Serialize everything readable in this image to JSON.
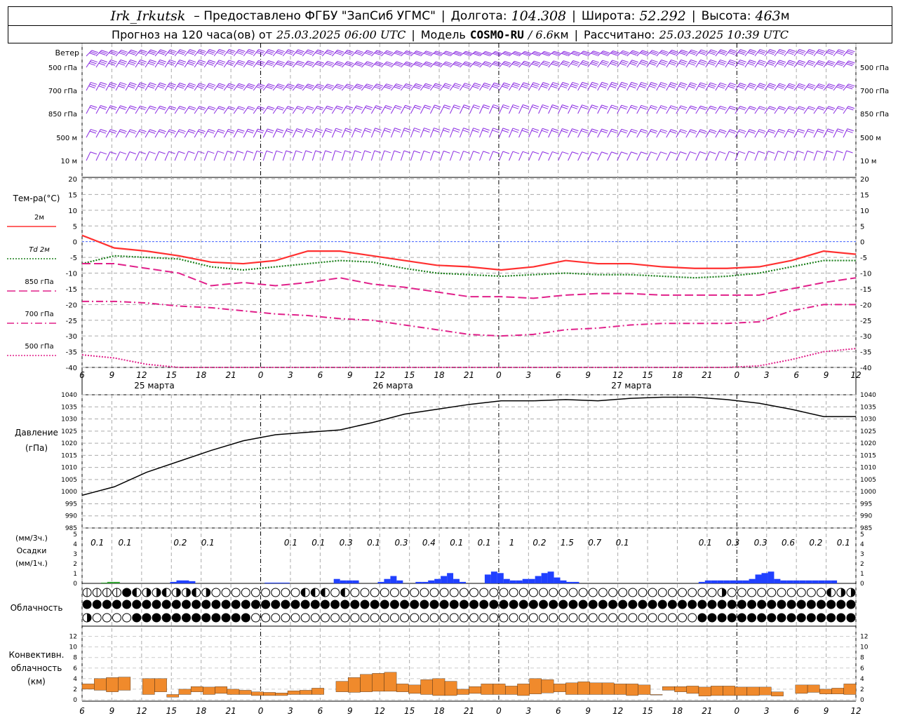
{
  "header": {
    "station": "Irk_Irkutsk",
    "provider": "– Предоставлено ФГБУ \"ЗапСиб УГМС\"",
    "lon_label": "Долгота:",
    "lon_value": "104.308",
    "lat_label": "Широта:",
    "lat_value": "52.292",
    "alt_label": "Высота:",
    "alt_value": "463",
    "alt_unit": "м",
    "forecast_label": "Прогноз на 120 часа(ов) от",
    "forecast_start": "25.03.2025 06:00 UTC",
    "model_label": "Модель",
    "model_name": "COSMO-RU",
    "model_res": "/ 6.6",
    "model_res_unit": "км",
    "calc_label": "Рассчитано:",
    "calc_time": "25.03.2025 10:39 UTC"
  },
  "panels": {
    "wind": {
      "title": "Ветер",
      "levels": [
        "500 гПа",
        "700 гПа",
        "850 гПа",
        "500 м",
        "10  м"
      ],
      "color": "#8a2be2"
    },
    "temp": {
      "title": "Тем-ра(°C)",
      "legend": [
        {
          "label": "2м",
          "color": "#ff3030",
          "dash": ""
        },
        {
          "label": "Td  2м",
          "color": "#1a7f1a",
          "dash": "2,2"
        },
        {
          "label": "850 гПа",
          "color": "#e0208a",
          "dash": "12,5"
        },
        {
          "label": "700 гПа",
          "color": "#e0208a",
          "dash": "10,4,2,4"
        },
        {
          "label": "500 гПа",
          "color": "#e0208a",
          "dash": "2,2"
        }
      ]
    },
    "pressure": {
      "title1": "Давление",
      "title2": "(гПа)"
    },
    "precip": {
      "unit3h": "(мм/3ч.)",
      "title": "Осадки",
      "unit1h": "(мм/1ч.)"
    },
    "cloud": {
      "title": "Облачность"
    },
    "conv": {
      "title1": "Конвективн.",
      "title2": "облачность",
      "title3": "(км)"
    }
  },
  "chart_data": {
    "type": "line",
    "x_hours_utc": [
      "6",
      "9",
      "12",
      "15",
      "18",
      "21",
      "0",
      "3",
      "6",
      "9",
      "12",
      "15",
      "18",
      "21",
      "0",
      "3",
      "6",
      "9",
      "12",
      "15",
      "18",
      "21",
      "0",
      "3",
      "6",
      "9",
      "12"
    ],
    "date_labels": [
      "25 марта",
      "26 марта",
      "27 марта"
    ],
    "temperature": {
      "ylim": [
        -40,
        20
      ],
      "yticks": [
        "20",
        "15",
        "10",
        "5",
        "0",
        "-5",
        "-10",
        "-15",
        "-20",
        "-25",
        "-30",
        "-35",
        "-40"
      ],
      "series": [
        {
          "name": "2м",
          "values": [
            2,
            -2,
            -3,
            -4.5,
            -6.5,
            -7,
            -6,
            -3,
            -3,
            -4.5,
            -6,
            -7.5,
            -8,
            -9,
            -8,
            -6,
            -7,
            -7,
            -8,
            -8.5,
            -8.5,
            -8,
            -6,
            -3,
            -4
          ]
        },
        {
          "name": "Td  2м",
          "values": [
            -7,
            -4.5,
            -5,
            -5.5,
            -8,
            -9,
            -8,
            -7,
            -6,
            -6.5,
            -8.5,
            -10,
            -10.5,
            -11,
            -10.5,
            -10,
            -10.5,
            -10.5,
            -11,
            -11.5,
            -11,
            -10,
            -8,
            -6,
            -6
          ]
        },
        {
          "name": "850 гПа",
          "values": [
            -7,
            -7,
            -8.5,
            -10,
            -14,
            -13,
            -14,
            -13,
            -11.5,
            -13.5,
            -14.5,
            -16,
            -17.5,
            -17.5,
            -18,
            -17,
            -16.5,
            -16.5,
            -17,
            -17,
            -17,
            -17,
            -15,
            -13,
            -11.5
          ]
        },
        {
          "name": "700 гПа",
          "values": [
            -19,
            -19,
            -19.5,
            -20.5,
            -21,
            -22,
            -23,
            -23.5,
            -24.5,
            -25,
            -26.5,
            -28,
            -29.5,
            -30,
            -29.5,
            -28,
            -27.5,
            -26.5,
            -26,
            -26,
            -26,
            -25.5,
            -22,
            -20,
            -20
          ]
        },
        {
          "name": "500 гПа",
          "values": [
            -36,
            -37,
            -39,
            -40,
            -40.5,
            -41,
            -41,
            -41,
            -41,
            -41,
            -41.5,
            -42,
            -42,
            -42,
            -42,
            -42,
            -42,
            -42,
            -41,
            -41,
            -41,
            -39.5,
            -37.5,
            -35,
            -34
          ]
        }
      ]
    },
    "pressure": {
      "ylim": [
        985,
        1040
      ],
      "yticks": [
        "1040",
        "1035",
        "1030",
        "1025",
        "1020",
        "1015",
        "1010",
        "1005",
        "1000",
        "995",
        "990",
        "985"
      ],
      "values": [
        998.5,
        1002,
        1008,
        1012.5,
        1017,
        1021,
        1023.5,
        1024.5,
        1025.5,
        1028.5,
        1032,
        1034,
        1036,
        1037.5,
        1037.5,
        1038,
        1037.5,
        1038.5,
        1039,
        1039,
        1038,
        1036.5,
        1034,
        1031,
        1031
      ]
    },
    "precip_3h_labels": [
      "0.1",
      "0.1",
      "",
      "0.2",
      "0.1",
      "",
      "",
      "0.1",
      "0.1",
      "0.3",
      "0.1",
      "0.3",
      "0.4",
      "0.1",
      "0.1",
      "1",
      "0.2",
      "1.5",
      "0.7",
      "0.1",
      "",
      "",
      "0.1",
      "0.3",
      "0.3",
      "0.6",
      "0.2",
      "0.1"
    ],
    "precip_3h_label_slots": [
      0,
      1,
      2,
      3,
      4,
      5,
      6,
      7,
      8,
      9,
      10,
      11,
      12,
      13,
      14,
      15,
      16,
      17,
      18,
      19,
      20,
      21,
      22,
      23,
      24,
      25,
      26,
      27
    ],
    "precip_ylim": [
      0,
      5
    ],
    "precip_yticks": [
      "5",
      "4",
      "3",
      "2",
      "1",
      "0"
    ],
    "precip_1h": [
      0,
      0,
      0,
      0.05,
      0.1,
      0.1,
      0,
      0,
      0,
      0,
      0,
      0,
      0,
      0,
      0.1,
      0.2,
      0.2,
      0.15,
      0,
      0,
      0,
      0,
      0,
      0,
      0,
      0,
      0,
      0,
      0,
      0.05,
      0.05,
      0.05,
      0.05,
      0,
      0,
      0,
      0,
      0,
      0,
      0,
      0.3,
      0.2,
      0.2,
      0.2,
      0,
      0,
      0,
      0.1,
      0.3,
      0.5,
      0.2,
      0,
      0,
      0.1,
      0.1,
      0.2,
      0.3,
      0.5,
      0.7,
      0.3,
      0.1,
      0,
      0,
      0,
      0.6,
      0.8,
      0.7,
      0.3,
      0.2,
      0.2,
      0.3,
      0.3,
      0.5,
      0.7,
      0.8,
      0.4,
      0.2,
      0.1,
      0.1,
      0,
      0,
      0,
      0,
      0,
      0,
      0,
      0,
      0,
      0,
      0,
      0,
      0,
      0,
      0,
      0,
      0,
      0,
      0,
      0.1,
      0.2,
      0.2,
      0.2,
      0.2,
      0.2,
      0.2,
      0.2,
      0.3,
      0.6,
      0.7,
      0.8,
      0.3,
      0.2,
      0.2,
      0.2,
      0.2,
      0.2,
      0.2,
      0.2,
      0.2,
      0.2,
      0,
      0,
      0
    ],
    "conv_cloud_ylim": [
      0,
      13
    ],
    "conv_cloud_yticks": [
      "12",
      "10",
      "8",
      "6",
      "4",
      "2",
      "0"
    ],
    "conv_cloud_km": [
      [
        2,
        3
      ],
      [
        1.8,
        4
      ],
      [
        1.5,
        4.2
      ],
      [
        1.8,
        4.3
      ],
      [
        0,
        0
      ],
      [
        1,
        4
      ],
      [
        1.5,
        4
      ],
      [
        0.5,
        1
      ],
      [
        1,
        2
      ],
      [
        1.5,
        2.5
      ],
      [
        1,
        2.4
      ],
      [
        1.2,
        2.5
      ],
      [
        1,
        2
      ],
      [
        1,
        1.8
      ],
      [
        0.8,
        1.5
      ],
      [
        0.8,
        1.4
      ],
      [
        0.8,
        1.3
      ],
      [
        1,
        1.7
      ],
      [
        1,
        1.8
      ],
      [
        1,
        2.2
      ],
      [
        0,
        0
      ],
      [
        1.5,
        3.5
      ],
      [
        1.4,
        4.2
      ],
      [
        1.5,
        4.8
      ],
      [
        1.6,
        5
      ],
      [
        1.6,
        5.2
      ],
      [
        1.5,
        3
      ],
      [
        1.2,
        2.8
      ],
      [
        1,
        3.8
      ],
      [
        0.8,
        4
      ],
      [
        0.8,
        3.5
      ],
      [
        1,
        2
      ],
      [
        1.2,
        2.5
      ],
      [
        1,
        3
      ],
      [
        1,
        3
      ],
      [
        1,
        2.6
      ],
      [
        0.8,
        3
      ],
      [
        1.1,
        4
      ],
      [
        1.3,
        3.8
      ],
      [
        1.5,
        3
      ],
      [
        1,
        3.2
      ],
      [
        1,
        3.4
      ],
      [
        1,
        3.2
      ],
      [
        1,
        3.2
      ],
      [
        1,
        3
      ],
      [
        0.8,
        3
      ],
      [
        1,
        2.8
      ],
      [
        0.9,
        1
      ],
      [
        1.8,
        2.5
      ],
      [
        1.5,
        2.5
      ],
      [
        1.2,
        2.6
      ],
      [
        0.7,
        2.4
      ],
      [
        0.8,
        2.6
      ],
      [
        0.8,
        2.6
      ],
      [
        0.8,
        2.4
      ],
      [
        0.8,
        2.4
      ],
      [
        0.9,
        2.4
      ],
      [
        0.7,
        1.5
      ],
      [
        0,
        0
      ],
      [
        1.2,
        2.8
      ],
      [
        1.4,
        2.8
      ],
      [
        1.1,
        2
      ],
      [
        1.1,
        2.2
      ],
      [
        1,
        3
      ]
    ],
    "cloud_rows": {
      "high": "11111●◐◐◑◐◑◐◐◑◑◐◐◑○○○○○○○○○○○○○○◐◑◐◐◐○◐◑○○○○○○○○○○○○○○○○○○○○○○○○○○○○○○○○○○○○○○○○○○○○○○○○○○○○○○○◑○○○○○○○○○○○○○○○◐◑◑◑◑",
      "mid": "●●●●●●●●●●●●●●●●●●●●●●●●●●●●●●●●●●●●●●●●●●●●●●●●●●●●●●●●●●●●●●●●●●●●●●●●●●●●●●●●●●●●●●●●●●●●●●●●●●●●●",
      "low": "◑○○○○○●●●●●●●●●●●●●●●●○○○○○○○○○○○○○○○○○○○○○○○○○○○○○○○○○○○○○○○○○○○○○○○○○○○○○○○○○●●●●●●●●●●●●●●●●●●●●●●"
    }
  }
}
